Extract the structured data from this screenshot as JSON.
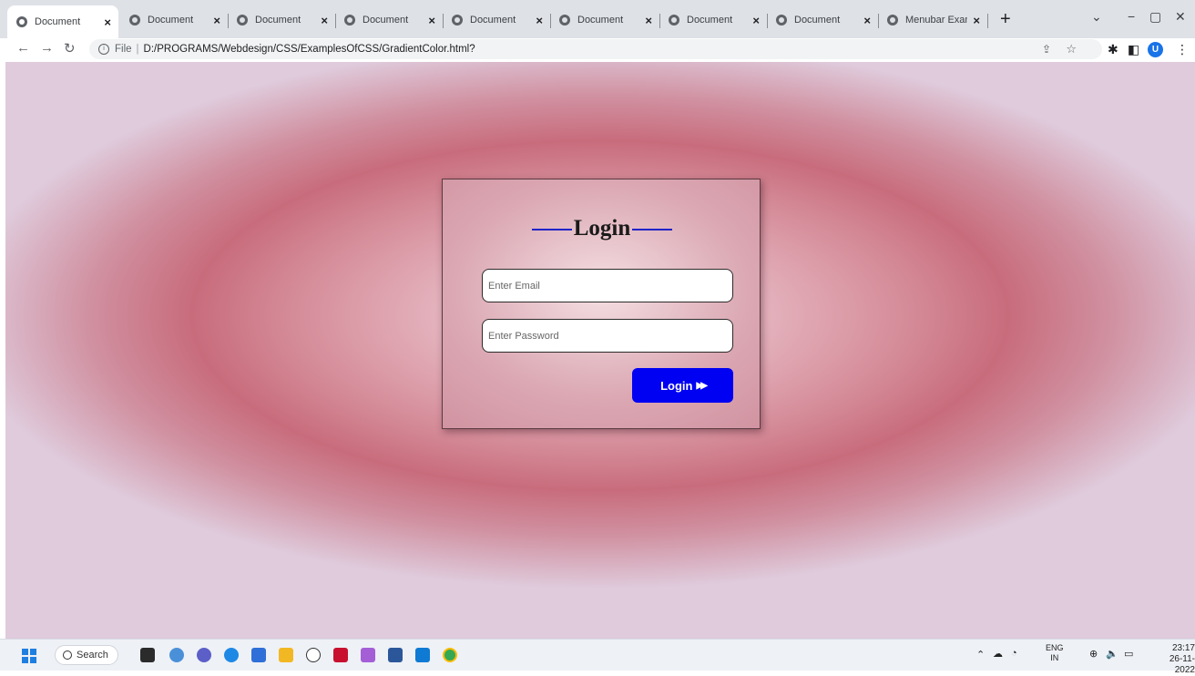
{
  "browser": {
    "tabs": [
      {
        "title": "Document",
        "active": true
      },
      {
        "title": "Document",
        "active": false
      },
      {
        "title": "Document",
        "active": false
      },
      {
        "title": "Document",
        "active": false
      },
      {
        "title": "Document",
        "active": false
      },
      {
        "title": "Document",
        "active": false
      },
      {
        "title": "Document",
        "active": false
      },
      {
        "title": "Document",
        "active": false
      },
      {
        "title": "Menubar Exam",
        "active": false
      }
    ],
    "tab_close_glyph": "×",
    "new_tab_glyph": "+",
    "url_scheme": "File",
    "url": "D:/PROGRAMS/Webdesign/CSS/ExamplesOfCSS/GradientColor.html?",
    "profile_initial": "U"
  },
  "login": {
    "title": "Login",
    "email_placeholder": "Enter Email",
    "password_placeholder": "Enter Password",
    "button_label": "Login",
    "button_icon": "fast-forward-icon"
  },
  "taskbar": {
    "search_label": "Search",
    "language": "ENG",
    "region": "IN",
    "time": "23:17",
    "date": "26-11-2022"
  },
  "colors": {
    "button": "#0000f2",
    "title_dash": "#1e24c8",
    "page_gradient_inner": "#f2dde3",
    "page_gradient_ring": "#c86c7c"
  }
}
